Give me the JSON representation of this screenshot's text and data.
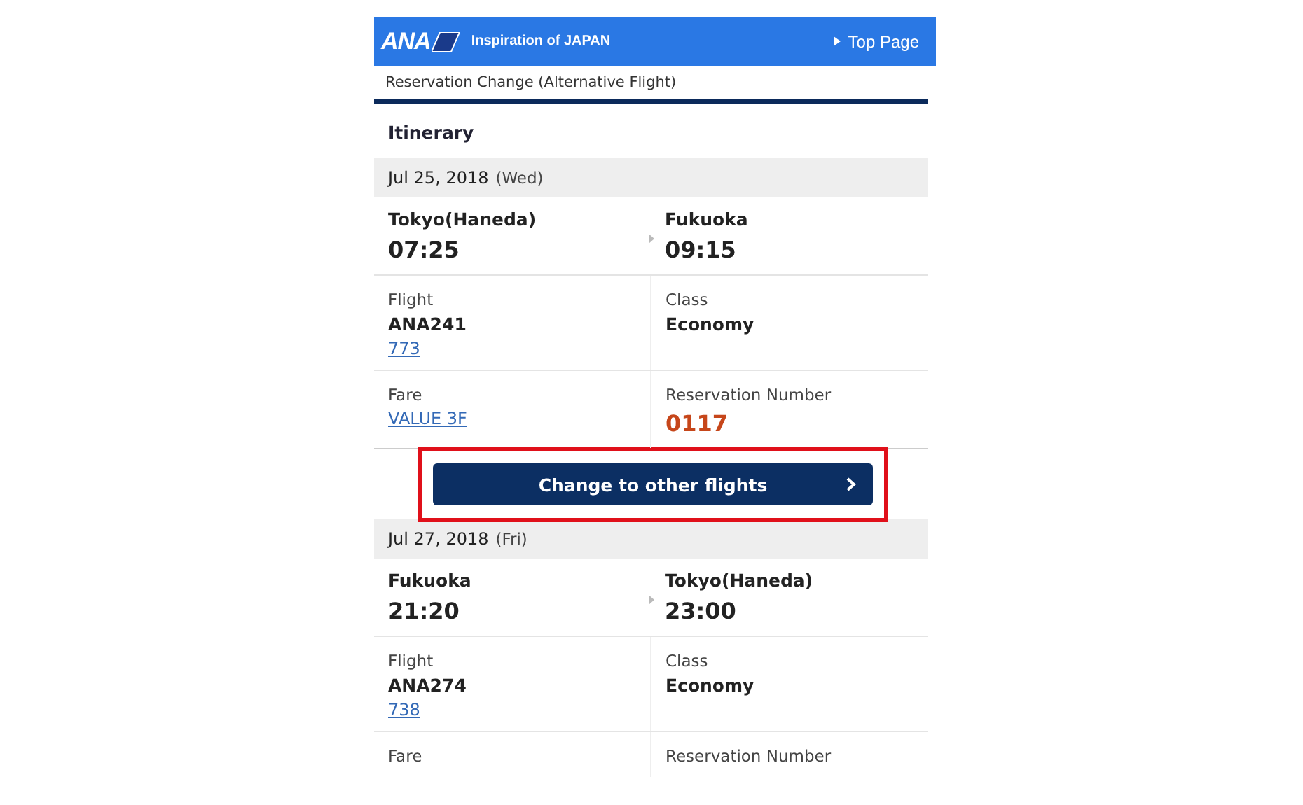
{
  "header": {
    "logo": "ANA",
    "tagline": "Inspiration of JAPAN",
    "top_link": "Top Page"
  },
  "page_title": "Reservation Change (Alternative Flight)",
  "section_title": "Itinerary",
  "segments": [
    {
      "date": "Jul 25, 2018",
      "weekday": "(Wed)",
      "from": "Tokyo(Haneda)",
      "departure": "07:25",
      "to": "Fukuoka",
      "arrival": "09:15",
      "flight_label": "Flight",
      "flight": "ANA241",
      "aircraft": "773",
      "class_label": "Class",
      "class": "Economy",
      "fare_label": "Fare",
      "fare": "VALUE 3F",
      "reservation_label": "Reservation Number",
      "reservation_number": "0117",
      "action": {
        "label": "Change to other flights",
        "highlighted": true
      }
    },
    {
      "date": "Jul 27, 2018",
      "weekday": "(Fri)",
      "from": "Fukuoka",
      "departure": "21:20",
      "to": "Tokyo(Haneda)",
      "arrival": "23:00",
      "flight_label": "Flight",
      "flight": "ANA274",
      "aircraft": "738",
      "class_label": "Class",
      "class": "Economy",
      "fare_label": "Fare",
      "reservation_label": "Reservation Number"
    }
  ]
}
